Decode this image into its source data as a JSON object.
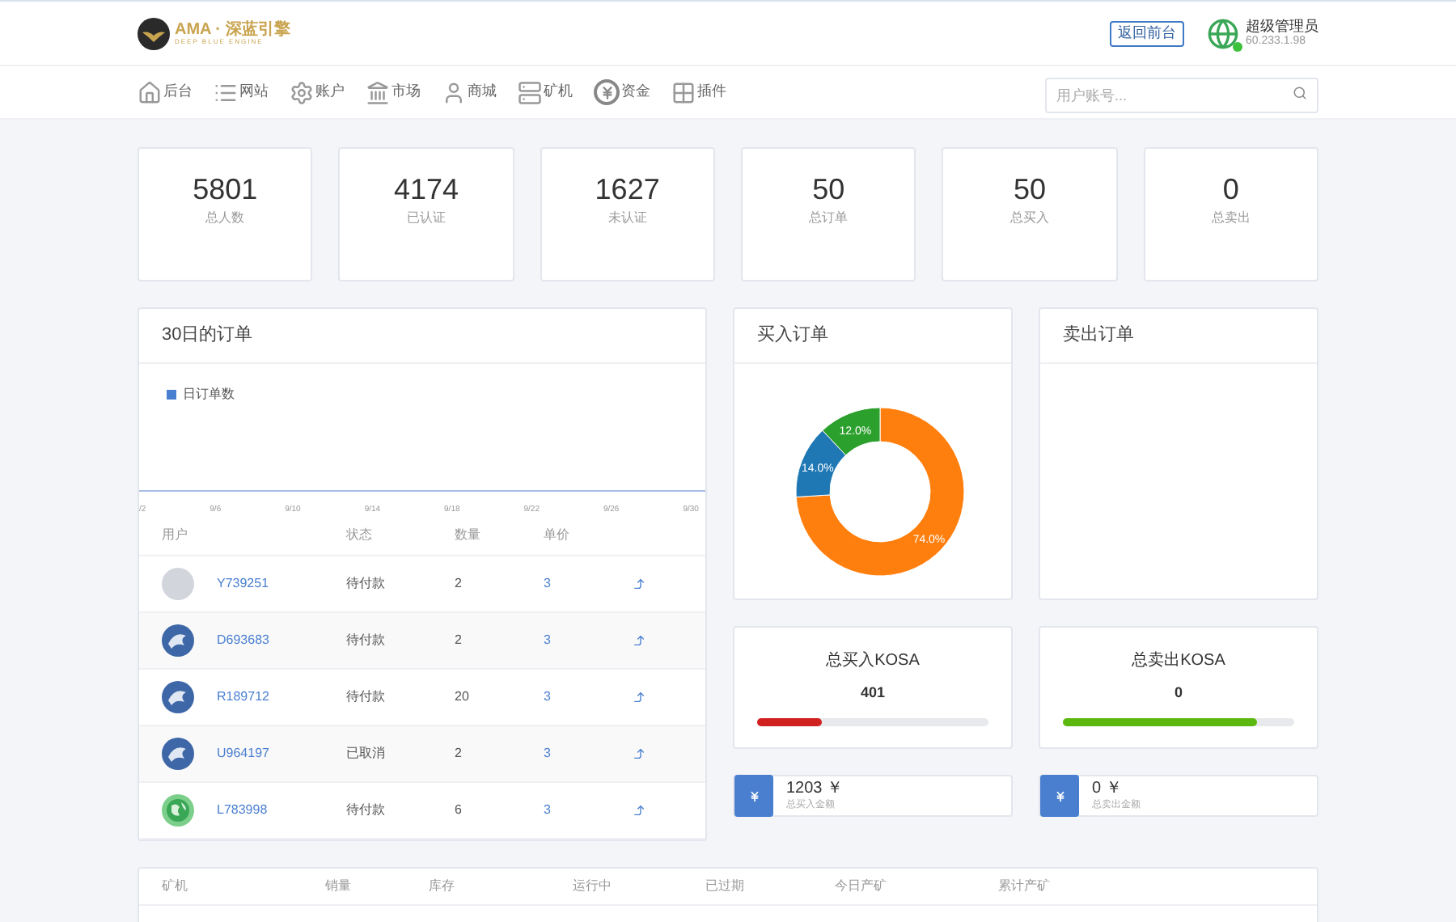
{
  "header": {
    "logo_text": "AMA · 深蓝引擎",
    "logo_subtitle": "DEEP BLUE ENGINE",
    "front_button": "返回前台",
    "user": {
      "name": "超级管理员",
      "ip": "60.233.1.98",
      "online": true
    }
  },
  "nav": {
    "items": [
      {
        "label": "后台",
        "kind": "home"
      },
      {
        "label": "网站",
        "kind": "list"
      },
      {
        "label": "账户",
        "kind": "gear"
      },
      {
        "label": "市场",
        "kind": "bank"
      },
      {
        "label": "商城",
        "kind": "user"
      },
      {
        "label": "矿机",
        "kind": "machine"
      },
      {
        "label": "资金",
        "kind": "money"
      },
      {
        "label": "插件",
        "kind": "grid"
      }
    ],
    "search": {
      "placeholder": "用户账号..."
    }
  },
  "stats": [
    {
      "value": "5801",
      "label": "总人数"
    },
    {
      "value": "4174",
      "label": "已认证"
    },
    {
      "value": "1627",
      "label": "未认证"
    },
    {
      "value": "50",
      "label": "总订单"
    },
    {
      "value": "50",
      "label": "总买入"
    },
    {
      "value": "0",
      "label": "总卖出"
    }
  ],
  "orders_panel": {
    "title": "30日的订单",
    "legend": "日订单数",
    "x_axis_labels": [
      "/2",
      "9/6",
      "9/10",
      "9/14",
      "9/18",
      "9/22",
      "9/26",
      "9/30"
    ],
    "columns": [
      "用户",
      "状态",
      "数量",
      "单价"
    ],
    "rows": [
      {
        "kind": "blank",
        "user": "Y739251",
        "status": "待付款",
        "qty": "2",
        "price": "3"
      },
      {
        "kind": "emblem",
        "user": "D693683",
        "status": "待付款",
        "qty": "2",
        "price": "3"
      },
      {
        "kind": "emblem",
        "user": "R189712",
        "status": "待付款",
        "qty": "20",
        "price": "3"
      },
      {
        "kind": "emblem",
        "user": "U964197",
        "status": "已取消",
        "qty": "2",
        "price": "3"
      },
      {
        "kind": "globe",
        "user": "L783998",
        "status": "待付款",
        "qty": "6",
        "price": "3"
      }
    ]
  },
  "buy_panel": {
    "title": "买入订单",
    "chart_data": {
      "type": "donut",
      "values": [
        74.0,
        14.0,
        12.0
      ],
      "value_labels": [
        "74.0%",
        "14.0%",
        "12.0%"
      ]
    }
  },
  "sell_panel": {
    "title": "卖出订单"
  },
  "kosa": [
    {
      "title": "总买入KOSA",
      "value": "401",
      "level": 0.28,
      "color": "#d0201f"
    },
    {
      "title": "总卖出KOSA",
      "value": "0",
      "level": 0.84,
      "color": "#5cb80e"
    }
  ],
  "amounts": [
    {
      "value": "1203 ￥",
      "label": "总买入金额"
    },
    {
      "value": "0 ￥",
      "label": "总卖出金额"
    }
  ],
  "machine_table": {
    "columns": [
      "矿机",
      "销量",
      "库存",
      "运行中",
      "已过期",
      "今日产矿",
      "累计产矿"
    ]
  }
}
